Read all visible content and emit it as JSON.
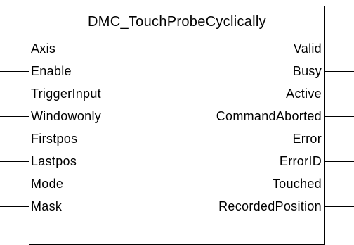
{
  "function_block": {
    "title": "DMC_TouchProbeCyclically"
  },
  "inputs": [
    {
      "label": "Axis"
    },
    {
      "label": "Enable"
    },
    {
      "label": "TriggerInput"
    },
    {
      "label": "Windowonly"
    },
    {
      "label": "Firstpos"
    },
    {
      "label": "Lastpos"
    },
    {
      "label": "Mode"
    },
    {
      "label": "Mask"
    }
  ],
  "outputs": [
    {
      "label": "Valid"
    },
    {
      "label": "Busy"
    },
    {
      "label": "Active"
    },
    {
      "label": "CommandAborted"
    },
    {
      "label": "Error"
    },
    {
      "label": "ErrorID"
    },
    {
      "label": "Touched"
    },
    {
      "label": "RecordedPosition"
    }
  ],
  "colors": {
    "line": "#000000",
    "background": "#ffffff",
    "text": "#000000"
  }
}
